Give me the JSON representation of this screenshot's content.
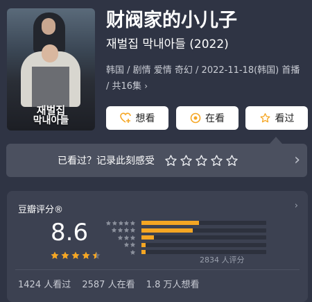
{
  "poster": {
    "title_line1": "재벌집",
    "title_line2": "막내아들"
  },
  "title": "财阀家的小儿子",
  "subtitle": "재벌집 막내아들 (2022)",
  "meta": {
    "text": "韩国 / 剧情 爱情 奇幻 / 2022-11-18(韩国) 首播 / 共16集",
    "chevron": "›"
  },
  "buttons": [
    {
      "label": "想看",
      "icon": "heart-plus-icon"
    },
    {
      "label": "在看",
      "icon": "circle-dot-icon"
    },
    {
      "label": "看过",
      "icon": "star-outline-icon"
    }
  ],
  "record": {
    "text": "已看过？记录此刻感受",
    "chevron": "›",
    "star_count": 5
  },
  "rating": {
    "label": "豆瓣评分®",
    "score": "8.6",
    "stars_value": 4.5,
    "distribution": [
      0.46,
      0.41,
      0.1,
      0.03,
      0.01
    ],
    "count_text": "2834 人评分",
    "chevron": "›"
  },
  "stats": {
    "watched": "1424 人看过",
    "watching": "2587 人在看",
    "want": "1.8 万人想看"
  },
  "colors": {
    "accent": "#f5a623",
    "background": "#2f3444",
    "card": "#3c4151"
  }
}
